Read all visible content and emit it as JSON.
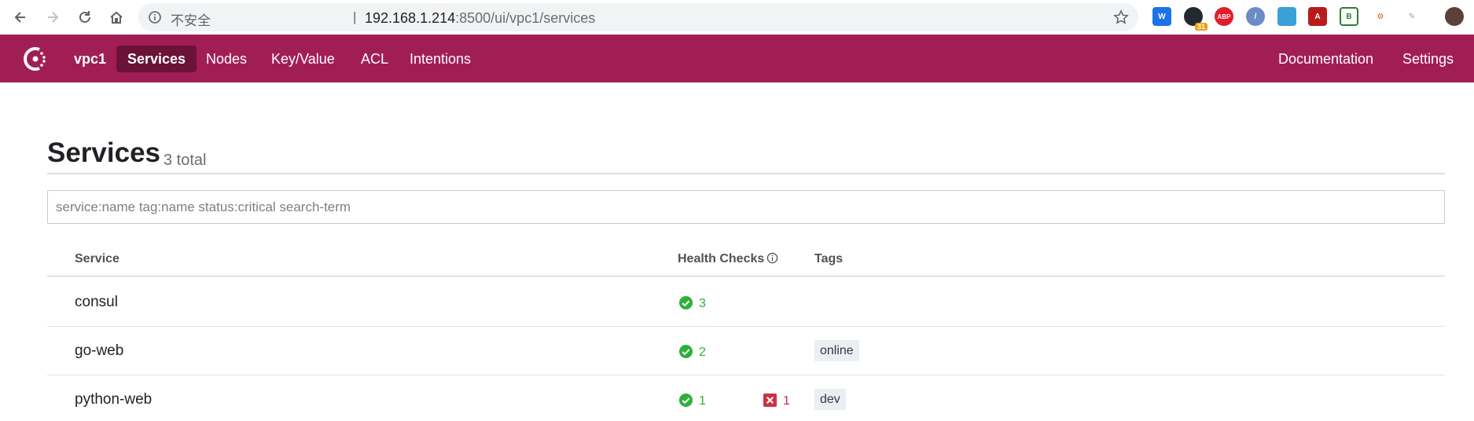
{
  "browser": {
    "security_label": "不安全",
    "separator": "|",
    "url_host": "192.168.1.214",
    "url_rest": ":8500/ui/vpc1/services",
    "extension_badge": "31",
    "extensions": [
      "w-icon",
      "github-icon",
      "abp-icon",
      "pen-icon",
      "shield-icon",
      "pdf-icon",
      "leaf-icon",
      "graph-icon",
      "tag-icon",
      "avatar"
    ]
  },
  "nav": {
    "datacenter": "vpc1",
    "items": [
      {
        "label": "Services",
        "active": true
      },
      {
        "label": "Nodes",
        "active": false
      },
      {
        "label": "Key/Value",
        "active": false
      },
      {
        "label": "ACL",
        "active": false
      },
      {
        "label": "Intentions",
        "active": false
      }
    ],
    "right_items": [
      {
        "label": "Documentation"
      },
      {
        "label": "Settings"
      }
    ],
    "brand_color": "#a11e55",
    "active_color": "#6a1337"
  },
  "page": {
    "title": "Services",
    "count": "3 total"
  },
  "search": {
    "placeholder": "service:name tag:name status:critical search-term",
    "value": ""
  },
  "table": {
    "headers": {
      "service": "Service",
      "health": "Health Checks",
      "tags": "Tags"
    },
    "rows": [
      {
        "name": "consul",
        "passing": "3",
        "critical": null,
        "tag": null
      },
      {
        "name": "go-web",
        "passing": "2",
        "critical": null,
        "tag": "online"
      },
      {
        "name": "python-web",
        "passing": "1",
        "critical": "1",
        "tag": "dev"
      }
    ]
  },
  "colors": {
    "passing": "#2eb039",
    "critical": "#c73445"
  }
}
